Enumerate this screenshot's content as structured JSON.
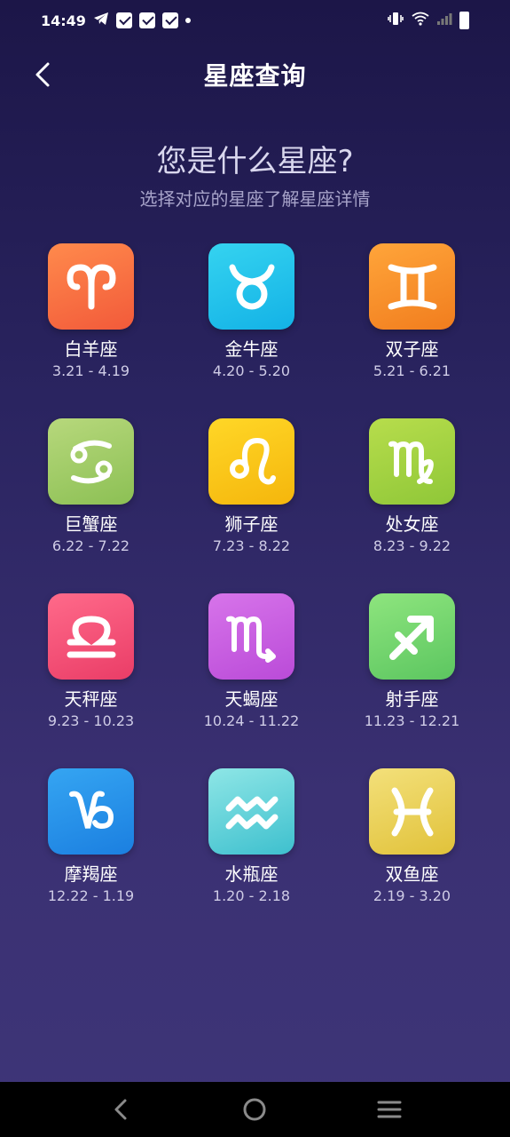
{
  "status": {
    "time": "14:49"
  },
  "header": {
    "title": "星座查询"
  },
  "intro": {
    "question": "您是什么星座?",
    "subtitle": "选择对应的星座了解星座详情"
  },
  "zodiacs": [
    {
      "name": "白羊座",
      "date": "3.21 - 4.19",
      "icon": "aries-icon",
      "colors": [
        "#ff8a4c",
        "#f25a3a"
      ]
    },
    {
      "name": "金牛座",
      "date": "4.20 - 5.20",
      "icon": "taurus-icon",
      "colors": [
        "#35d3f0",
        "#13b2e6"
      ]
    },
    {
      "name": "双子座",
      "date": "5.21 - 6.21",
      "icon": "gemini-icon",
      "colors": [
        "#ffa53a",
        "#f17d1e"
      ]
    },
    {
      "name": "巨蟹座",
      "date": "6.22 - 7.22",
      "icon": "cancer-icon",
      "colors": [
        "#b7d87c",
        "#8cc054"
      ]
    },
    {
      "name": "狮子座",
      "date": "7.23 - 8.22",
      "icon": "leo-icon",
      "colors": [
        "#ffd727",
        "#f5b60c"
      ]
    },
    {
      "name": "处女座",
      "date": "8.23 - 9.22",
      "icon": "virgo-icon",
      "colors": [
        "#b7dd4c",
        "#8fc738"
      ]
    },
    {
      "name": "天秤座",
      "date": "9.23 - 10.23",
      "icon": "libra-icon",
      "colors": [
        "#ff6a8a",
        "#ea3d67"
      ]
    },
    {
      "name": "天蝎座",
      "date": "10.24 - 11.22",
      "icon": "scorpio-icon",
      "colors": [
        "#d774ea",
        "#ba4bd8"
      ]
    },
    {
      "name": "射手座",
      "date": "11.23 - 12.21",
      "icon": "sagittarius-icon",
      "colors": [
        "#8ee57e",
        "#5cc660"
      ]
    },
    {
      "name": "摩羯座",
      "date": "12.22 - 1.19",
      "icon": "capricorn-icon",
      "colors": [
        "#35a5f2",
        "#1b7fe0"
      ]
    },
    {
      "name": "水瓶座",
      "date": "1.20 - 2.18",
      "icon": "aquarius-icon",
      "colors": [
        "#8ee6e6",
        "#3ec0ce"
      ]
    },
    {
      "name": "双鱼座",
      "date": "2.19 - 3.20",
      "icon": "pisces-icon",
      "colors": [
        "#f3e07a",
        "#e1c23a"
      ]
    }
  ]
}
